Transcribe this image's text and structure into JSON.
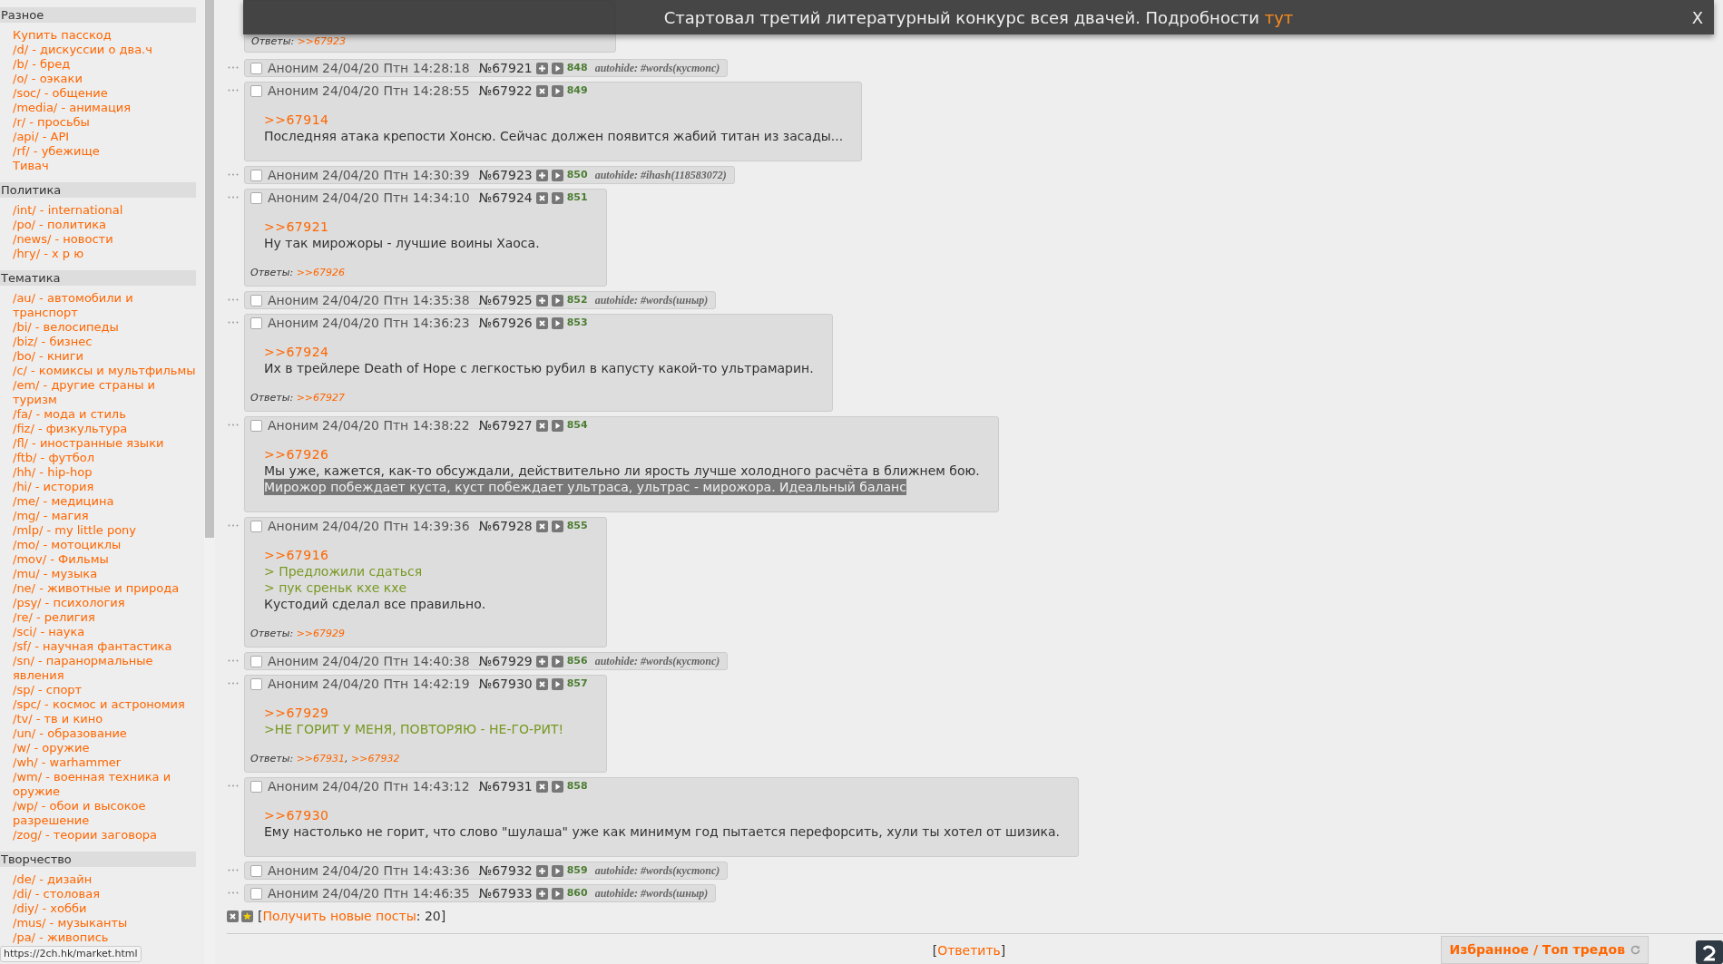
{
  "banner": {
    "text": "Стартовал третий литературный конкурс всея двачей. Подробности",
    "link": "тут",
    "close": "X"
  },
  "sidebar": {
    "sections": [
      {
        "title": "Разное",
        "items": [
          "Купить пасскод",
          "/d/ - дискуссии о два.ч",
          "/b/ - бред",
          "/o/ - оэкаки",
          "/soc/ - общение",
          "/media/ - анимация",
          "/r/ - просьбы",
          "/api/ - API",
          "/rf/ - убежище",
          "Тивач"
        ]
      },
      {
        "title": "Политика",
        "items": [
          "/int/ - international",
          "/po/ - политика",
          "/news/ - новости",
          "/hry/ - х р ю"
        ]
      },
      {
        "title": "Тематика",
        "items": [
          "/au/ - автомобили и транспорт",
          "/bi/ - велосипеды",
          "/biz/ - бизнес",
          "/bo/ - книги",
          "/c/ - комиксы и мультфильмы",
          "/em/ - другие страны и туризм",
          "/fa/ - мода и стиль",
          "/fiz/ - физкультура",
          "/fl/ - иностранные языки",
          "/ftb/ - футбол",
          "/hh/ - hip-hop",
          "/hi/ - история",
          "/me/ - медицина",
          "/mg/ - магия",
          "/mlp/ - my little pony",
          "/mo/ - мотоциклы",
          "/mov/ - Фильмы",
          "/mu/ - музыка",
          "/ne/ - животные и природа",
          "/psy/ - психология",
          "/re/ - религия",
          "/sci/ - наука",
          "/sf/ - научная фантастика",
          "/sn/ - паранормальные явления",
          "/sp/ - спорт",
          "/spc/ - космос и астрономия",
          "/tv/ - тв и кино",
          "/un/ - образование",
          "/w/ - оружие",
          "/wh/ - warhammer",
          "/wm/ - военная техника и оружие",
          "/wp/ - обои и высокое разрешение",
          "/zog/ - теории заговора"
        ]
      },
      {
        "title": "Творчество",
        "items": [
          "/de/ - дизайн",
          "/di/ - столовая",
          "/diy/ - хобби",
          "/mus/ - музыканты",
          "/pa/ - живопись"
        ]
      }
    ]
  },
  "partial_post": {
    "replies_label": "Ответы:",
    "replies": [
      {
        "link": ">>67923"
      }
    ]
  },
  "posts": [
    {
      "kind": "hidden",
      "checked": false,
      "name": "Аноним",
      "datetime": "24/04/20 Птн 14:28:18",
      "number": "№67921",
      "index": "848",
      "autohide": "autohide: #words(кустопс)"
    },
    {
      "kind": "full",
      "checked": false,
      "name": "Аноним",
      "datetime": "24/04/20 Птн 14:28:55",
      "number": "№67922",
      "index": "849",
      "lines": [
        {
          "kind": "link",
          "text": ">>67914"
        },
        {
          "kind": "text",
          "text": "Последняя атака крепости Хонсю. Сейчас должен появится жабий титан из засады..."
        }
      ]
    },
    {
      "kind": "hidden",
      "checked": false,
      "name": "Аноним",
      "datetime": "24/04/20 Птн 14:30:39",
      "number": "№67923",
      "index": "850",
      "autohide": "autohide: #ihash(118583072)"
    },
    {
      "kind": "full",
      "checked": false,
      "name": "Аноним",
      "datetime": "24/04/20 Птн 14:34:10",
      "number": "№67924",
      "index": "851",
      "lines": [
        {
          "kind": "link",
          "text": ">>67921"
        },
        {
          "kind": "text",
          "text": "Ну так мирожоры - лучшие воины Хаоса."
        }
      ],
      "replies_label": "Ответы:",
      "replies": [
        {
          "link": ">>67926"
        }
      ]
    },
    {
      "kind": "hidden",
      "checked": false,
      "name": "Аноним",
      "datetime": "24/04/20 Птн 14:35:38",
      "number": "№67925",
      "index": "852",
      "autohide": "autohide: #words(шныр)"
    },
    {
      "kind": "full",
      "checked": false,
      "name": "Аноним",
      "datetime": "24/04/20 Птн 14:36:23",
      "number": "№67926",
      "index": "853",
      "lines": [
        {
          "kind": "link",
          "text": ">>67924"
        },
        {
          "kind": "text",
          "text": "Их в трейлере Death of Hope с легкостью рубил в капусту какой-то ультрамарин."
        }
      ],
      "replies_label": "Ответы:",
      "replies": [
        {
          "link": ">>67927"
        }
      ]
    },
    {
      "kind": "full",
      "checked": false,
      "name": "Аноним",
      "datetime": "24/04/20 Птн 14:38:22",
      "number": "№67927",
      "index": "854",
      "lines": [
        {
          "kind": "link",
          "text": ">>67926"
        },
        {
          "kind": "text",
          "text": "Мы уже, кажется, как-то обсуждали, действительно ли ярость лучше холодного расчёта в ближнем бою."
        },
        {
          "kind": "highlighted",
          "text": "Мирожор побеждает куста, куст побеждает ультраса, ультрас - мирожора. Идеальный баланс"
        }
      ]
    },
    {
      "kind": "full",
      "checked": false,
      "name": "Аноним",
      "datetime": "24/04/20 Птн 14:39:36",
      "number": "№67928",
      "index": "855",
      "lines": [
        {
          "kind": "link",
          "text": ">>67916"
        },
        {
          "kind": "quote",
          "text": "> Предложили сдаться"
        },
        {
          "kind": "quote",
          "text": "> пук среньк кхе кхе"
        },
        {
          "kind": "text",
          "text": "Кустодий сделал все правильно."
        }
      ],
      "replies_label": "Ответы:",
      "replies": [
        {
          "link": ">>67929"
        }
      ]
    },
    {
      "kind": "hidden",
      "checked": false,
      "name": "Аноним",
      "datetime": "24/04/20 Птн 14:40:38",
      "number": "№67929",
      "index": "856",
      "autohide": "autohide: #words(кустопс)"
    },
    {
      "kind": "full",
      "checked": false,
      "name": "Аноним",
      "datetime": "24/04/20 Птн 14:42:19",
      "number": "№67930",
      "index": "857",
      "lines": [
        {
          "kind": "link",
          "text": ">>67929"
        },
        {
          "kind": "quote",
          "text": ">НЕ ГОРИТ У МЕНЯ, ПОВТОРЯЮ - НЕ-ГО-РИТ!"
        }
      ],
      "replies_label": "Ответы:",
      "replies": [
        {
          "link": ">>67931",
          "after": ","
        },
        {
          "link": ">>67932"
        }
      ]
    },
    {
      "kind": "full",
      "checked": false,
      "name": "Аноним",
      "datetime": "24/04/20 Птн 14:43:12",
      "number": "№67931",
      "index": "858",
      "lines": [
        {
          "kind": "link",
          "text": ">>67930"
        },
        {
          "kind": "text",
          "text": "Ему настолько не горит, что слово \"шулаша\" уже как минимум год пытается перефорсить, хули ты хотел от шизика."
        }
      ]
    },
    {
      "kind": "hidden",
      "checked": false,
      "name": "Аноним",
      "datetime": "24/04/20 Птн 14:43:36",
      "number": "№67932",
      "index": "859",
      "autohide": "autohide: #words(кустопс)"
    },
    {
      "kind": "hidden",
      "checked": false,
      "name": "Аноним",
      "datetime": "24/04/20 Птн 14:46:35",
      "number": "№67933",
      "index": "860",
      "autohide": "autohide: #words(шныр)"
    }
  ],
  "new_posts": {
    "prefix": "[",
    "link": "Получить новые посты",
    "suffix": ": 20]"
  },
  "reply": {
    "prefix": "[",
    "link": "Ответить",
    "suffix": "]"
  },
  "favorites": "Избранное / Топ тредов",
  "status_url": "https://2ch.hk/market.html"
}
